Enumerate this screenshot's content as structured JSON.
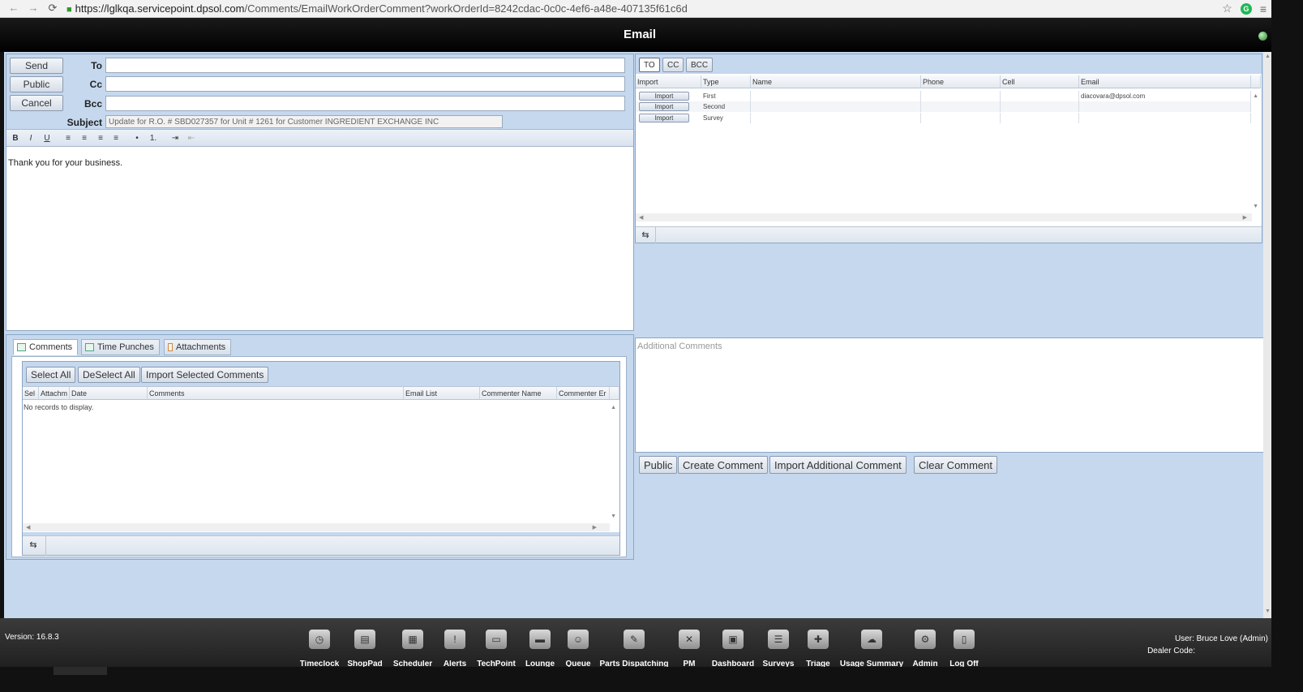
{
  "browser": {
    "url_host": "https://lglkqa.servicepoint.dpsol.com",
    "url_path": "/Comments/EmailWorkOrderComment?workOrderId=8242cdac-0c0c-4ef6-a48e-407135f61c6d",
    "back_icon": "←",
    "forward_icon": "→",
    "reload_icon": "⟳",
    "star_icon": "☆",
    "menu_icon": "≡",
    "grammarly": "G"
  },
  "header": {
    "title": "Email"
  },
  "email_form": {
    "send_label": "Send",
    "public_label": "Public",
    "cancel_label": "Cancel",
    "to_label": "To",
    "cc_label": "Cc",
    "bcc_label": "Bcc",
    "subject_label": "Subject",
    "to_value": "",
    "cc_value": "",
    "bcc_value": "",
    "subject_value": "Update for R.O. # SBD027357 for Unit # 1261 for Customer INGREDIENT EXCHANGE INC",
    "body": "Thank you for your business."
  },
  "editor_toolbar": [
    "B",
    "I",
    "U",
    "≡",
    "≡",
    "≡",
    "≡",
    "•",
    "1.",
    "⇥",
    "⇤"
  ],
  "recipients": {
    "tabs": [
      "TO",
      "CC",
      "BCC"
    ],
    "columns": [
      "Import",
      "Type",
      "Name",
      "Phone",
      "Cell",
      "Email"
    ],
    "rows": [
      {
        "import_label": "Import",
        "type": "First",
        "name": "",
        "phone": "",
        "cell": "",
        "email": "diacovara@dpsol.com"
      },
      {
        "import_label": "Import",
        "type": "Second",
        "name": "",
        "phone": "",
        "cell": "",
        "email": ""
      },
      {
        "import_label": "Import",
        "type": "Survey",
        "name": "",
        "phone": "",
        "cell": "",
        "email": ""
      }
    ]
  },
  "comments_panel": {
    "tabs": [
      "Comments",
      "Time Punches",
      "Attachments"
    ],
    "select_all": "Select All",
    "deselect_all": "DeSelect All",
    "import_selected": "Import Selected Comments",
    "columns": [
      "Sel",
      "Attachm",
      "Date",
      "Comments",
      "Email List",
      "Commenter Name",
      "Commenter Er"
    ],
    "empty_text": "No records to display."
  },
  "additional": {
    "placeholder": "Additional Comments",
    "public_label": "Public",
    "create_label": "Create Comment",
    "import_label": "Import Additional Comment",
    "clear_label": "Clear Comment"
  },
  "footer": {
    "version": "Version: 16.8.3",
    "user": "User: Bruce Love (Admin)",
    "dealer": "Dealer Code:",
    "dock": [
      {
        "label": "Timeclock",
        "icon": "clock-icon",
        "glyph": "◷"
      },
      {
        "label": "ShopPad",
        "icon": "notepad-icon",
        "glyph": "▤"
      },
      {
        "label": "Scheduler",
        "icon": "calendar-icon",
        "glyph": "▦"
      },
      {
        "label": "Alerts",
        "icon": "alerts-icon",
        "glyph": "!"
      },
      {
        "label": "TechPoint",
        "icon": "monitor-icon",
        "glyph": "▭"
      },
      {
        "label": "Lounge",
        "icon": "lounge-icon",
        "glyph": "▬"
      },
      {
        "label": "Queue",
        "icon": "people-icon",
        "glyph": "☺"
      },
      {
        "label": "Parts Dispatching",
        "icon": "parts-icon",
        "glyph": "✎"
      },
      {
        "label": "PM",
        "icon": "tools-icon",
        "glyph": "✕"
      },
      {
        "label": "Dashboard",
        "icon": "box-icon",
        "glyph": "▣"
      },
      {
        "label": "Surveys",
        "icon": "clipboard-icon",
        "glyph": "☰"
      },
      {
        "label": "Triage",
        "icon": "triage-icon",
        "glyph": "✚"
      },
      {
        "label": "Usage Summary",
        "icon": "cloud-icon",
        "glyph": "☁"
      },
      {
        "label": "Admin",
        "icon": "gear-icon",
        "glyph": "⚙"
      },
      {
        "label": "Log Off",
        "icon": "door-icon",
        "glyph": "▯"
      }
    ]
  }
}
